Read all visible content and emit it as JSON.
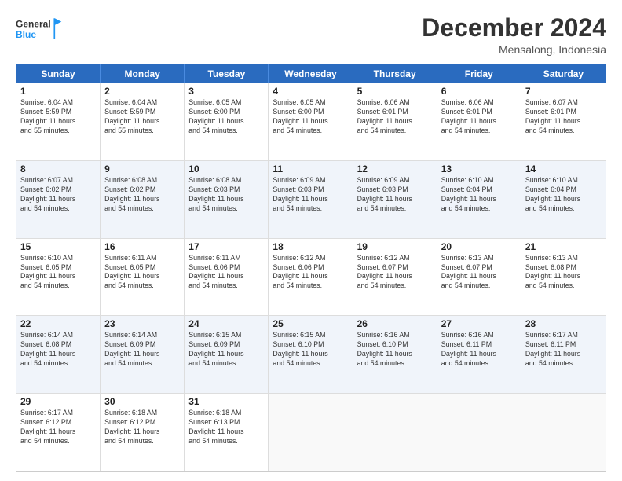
{
  "logo": {
    "line1": "General",
    "line2": "Blue"
  },
  "title": "December 2024",
  "location": "Mensalong, Indonesia",
  "days_of_week": [
    "Sunday",
    "Monday",
    "Tuesday",
    "Wednesday",
    "Thursday",
    "Friday",
    "Saturday"
  ],
  "weeks": [
    {
      "alt": false,
      "cells": [
        {
          "day": "1",
          "info": "Sunrise: 6:04 AM\nSunset: 5:59 PM\nDaylight: 11 hours\nand 55 minutes."
        },
        {
          "day": "2",
          "info": "Sunrise: 6:04 AM\nSunset: 5:59 PM\nDaylight: 11 hours\nand 55 minutes."
        },
        {
          "day": "3",
          "info": "Sunrise: 6:05 AM\nSunset: 6:00 PM\nDaylight: 11 hours\nand 54 minutes."
        },
        {
          "day": "4",
          "info": "Sunrise: 6:05 AM\nSunset: 6:00 PM\nDaylight: 11 hours\nand 54 minutes."
        },
        {
          "day": "5",
          "info": "Sunrise: 6:06 AM\nSunset: 6:01 PM\nDaylight: 11 hours\nand 54 minutes."
        },
        {
          "day": "6",
          "info": "Sunrise: 6:06 AM\nSunset: 6:01 PM\nDaylight: 11 hours\nand 54 minutes."
        },
        {
          "day": "7",
          "info": "Sunrise: 6:07 AM\nSunset: 6:01 PM\nDaylight: 11 hours\nand 54 minutes."
        }
      ]
    },
    {
      "alt": true,
      "cells": [
        {
          "day": "8",
          "info": "Sunrise: 6:07 AM\nSunset: 6:02 PM\nDaylight: 11 hours\nand 54 minutes."
        },
        {
          "day": "9",
          "info": "Sunrise: 6:08 AM\nSunset: 6:02 PM\nDaylight: 11 hours\nand 54 minutes."
        },
        {
          "day": "10",
          "info": "Sunrise: 6:08 AM\nSunset: 6:03 PM\nDaylight: 11 hours\nand 54 minutes."
        },
        {
          "day": "11",
          "info": "Sunrise: 6:09 AM\nSunset: 6:03 PM\nDaylight: 11 hours\nand 54 minutes."
        },
        {
          "day": "12",
          "info": "Sunrise: 6:09 AM\nSunset: 6:03 PM\nDaylight: 11 hours\nand 54 minutes."
        },
        {
          "day": "13",
          "info": "Sunrise: 6:10 AM\nSunset: 6:04 PM\nDaylight: 11 hours\nand 54 minutes."
        },
        {
          "day": "14",
          "info": "Sunrise: 6:10 AM\nSunset: 6:04 PM\nDaylight: 11 hours\nand 54 minutes."
        }
      ]
    },
    {
      "alt": false,
      "cells": [
        {
          "day": "15",
          "info": "Sunrise: 6:10 AM\nSunset: 6:05 PM\nDaylight: 11 hours\nand 54 minutes."
        },
        {
          "day": "16",
          "info": "Sunrise: 6:11 AM\nSunset: 6:05 PM\nDaylight: 11 hours\nand 54 minutes."
        },
        {
          "day": "17",
          "info": "Sunrise: 6:11 AM\nSunset: 6:06 PM\nDaylight: 11 hours\nand 54 minutes."
        },
        {
          "day": "18",
          "info": "Sunrise: 6:12 AM\nSunset: 6:06 PM\nDaylight: 11 hours\nand 54 minutes."
        },
        {
          "day": "19",
          "info": "Sunrise: 6:12 AM\nSunset: 6:07 PM\nDaylight: 11 hours\nand 54 minutes."
        },
        {
          "day": "20",
          "info": "Sunrise: 6:13 AM\nSunset: 6:07 PM\nDaylight: 11 hours\nand 54 minutes."
        },
        {
          "day": "21",
          "info": "Sunrise: 6:13 AM\nSunset: 6:08 PM\nDaylight: 11 hours\nand 54 minutes."
        }
      ]
    },
    {
      "alt": true,
      "cells": [
        {
          "day": "22",
          "info": "Sunrise: 6:14 AM\nSunset: 6:08 PM\nDaylight: 11 hours\nand 54 minutes."
        },
        {
          "day": "23",
          "info": "Sunrise: 6:14 AM\nSunset: 6:09 PM\nDaylight: 11 hours\nand 54 minutes."
        },
        {
          "day": "24",
          "info": "Sunrise: 6:15 AM\nSunset: 6:09 PM\nDaylight: 11 hours\nand 54 minutes."
        },
        {
          "day": "25",
          "info": "Sunrise: 6:15 AM\nSunset: 6:10 PM\nDaylight: 11 hours\nand 54 minutes."
        },
        {
          "day": "26",
          "info": "Sunrise: 6:16 AM\nSunset: 6:10 PM\nDaylight: 11 hours\nand 54 minutes."
        },
        {
          "day": "27",
          "info": "Sunrise: 6:16 AM\nSunset: 6:11 PM\nDaylight: 11 hours\nand 54 minutes."
        },
        {
          "day": "28",
          "info": "Sunrise: 6:17 AM\nSunset: 6:11 PM\nDaylight: 11 hours\nand 54 minutes."
        }
      ]
    },
    {
      "alt": false,
      "cells": [
        {
          "day": "29",
          "info": "Sunrise: 6:17 AM\nSunset: 6:12 PM\nDaylight: 11 hours\nand 54 minutes."
        },
        {
          "day": "30",
          "info": "Sunrise: 6:18 AM\nSunset: 6:12 PM\nDaylight: 11 hours\nand 54 minutes."
        },
        {
          "day": "31",
          "info": "Sunrise: 6:18 AM\nSunset: 6:13 PM\nDaylight: 11 hours\nand 54 minutes."
        },
        {
          "day": "",
          "info": ""
        },
        {
          "day": "",
          "info": ""
        },
        {
          "day": "",
          "info": ""
        },
        {
          "day": "",
          "info": ""
        }
      ]
    }
  ]
}
